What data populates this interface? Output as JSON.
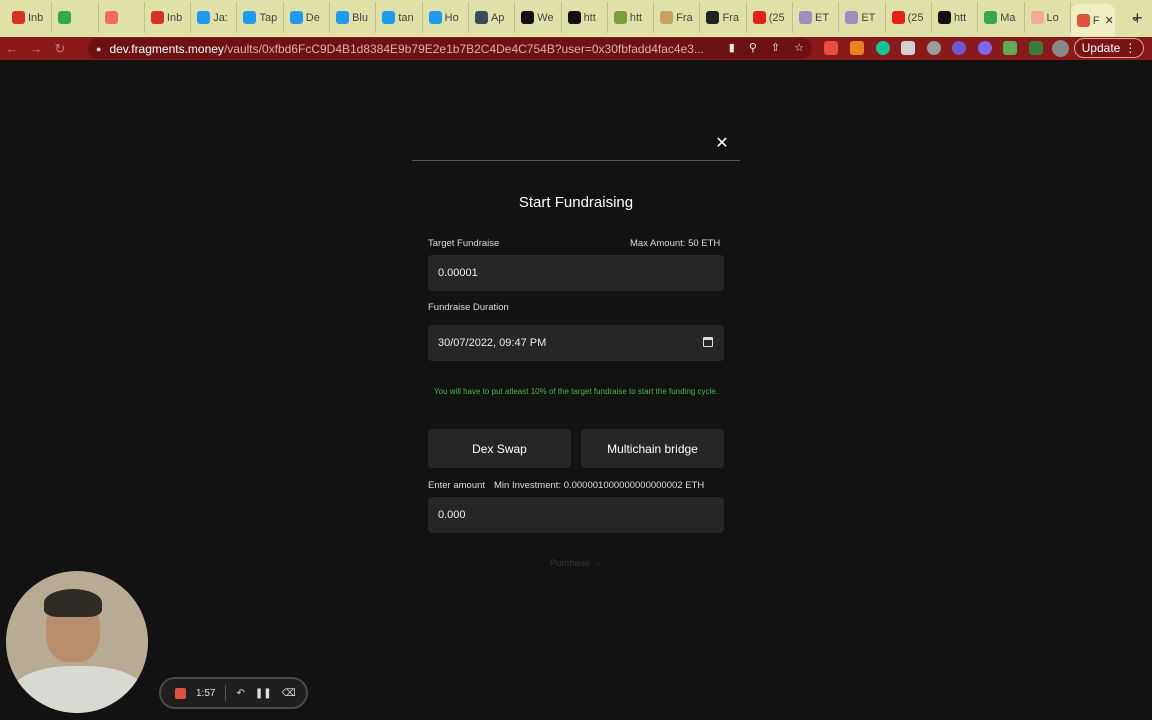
{
  "browser": {
    "tabs": [
      {
        "label": "Inb",
        "icon": "gmail-icon",
        "color": "#d93025"
      },
      {
        "label": "",
        "icon": "sheets-icon",
        "color": "#34a853"
      },
      {
        "label": "",
        "icon": "asana-icon",
        "color": "#f06a6a"
      },
      {
        "label": "Inb",
        "icon": "gmail-icon",
        "color": "#d93025"
      },
      {
        "label": "Ja:",
        "icon": "twitter-icon",
        "color": "#1d9bf0"
      },
      {
        "label": "Tap",
        "icon": "twitter-icon",
        "color": "#1d9bf0"
      },
      {
        "label": "De",
        "icon": "twitter-icon",
        "color": "#1d9bf0"
      },
      {
        "label": "Blu",
        "icon": "twitter-icon",
        "color": "#1d9bf0"
      },
      {
        "label": "tan",
        "icon": "twitter-icon",
        "color": "#1d9bf0"
      },
      {
        "label": "Ho",
        "icon": "twitter-icon",
        "color": "#1d9bf0"
      },
      {
        "label": "Ap",
        "icon": "app-icon",
        "color": "#3b4a5a"
      },
      {
        "label": "We",
        "icon": "circle-logo-icon",
        "color": "#111111"
      },
      {
        "label": "htt",
        "icon": "triangle-icon",
        "color": "#111111"
      },
      {
        "label": "htt",
        "icon": "feather-icon",
        "color": "#7b9e3c"
      },
      {
        "label": "Fra",
        "icon": "music-icon",
        "color": "#c8a060"
      },
      {
        "label": "Fra",
        "icon": "p-logo-icon",
        "color": "#222222"
      },
      {
        "label": "(25",
        "icon": "youtube-icon",
        "color": "#e62117"
      },
      {
        "label": "ET",
        "icon": "eth-icon",
        "color": "#9a8fbf"
      },
      {
        "label": "ET",
        "icon": "eth-icon",
        "color": "#9a8fbf"
      },
      {
        "label": "(25",
        "icon": "youtube-icon",
        "color": "#e62117"
      },
      {
        "label": "htt",
        "icon": "triangle-icon",
        "color": "#111111"
      },
      {
        "label": "Ma",
        "icon": "drive-icon",
        "color": "#34a853"
      },
      {
        "label": "Lo",
        "icon": "loom-icon",
        "color": "#f4a896"
      },
      {
        "label": "F",
        "icon": "recording-icon",
        "color": "#e25241"
      }
    ],
    "url_host": "dev.fragments.money",
    "url_path": "/vaults/0xfbd6FcC9D4B1d8384E9b79E2e1b7B2C4De4C754B?user=0x30fbfadd4fac4e3...",
    "update_label": "Update"
  },
  "modal": {
    "title": "Start Fundraising",
    "target_label": "Target Fundraise",
    "max_amount": "Max Amount: 50 ETH",
    "target_value": "0.00001",
    "duration_label": "Fundraise Duration",
    "duration_value": "30/07/2022, 09:47 PM",
    "note": "You will have to put atleast 10% of the target fundraise to start the funding cycle.",
    "dex_swap": "Dex Swap",
    "multichain_bridge": "Multichain bridge",
    "amount_label": "Enter amount",
    "min_investment": "Min Investment: 0.000001000000000000002 ETH",
    "amount_value": "0.000",
    "purchase": "Purchase"
  },
  "recorder": {
    "time": "1:57"
  }
}
